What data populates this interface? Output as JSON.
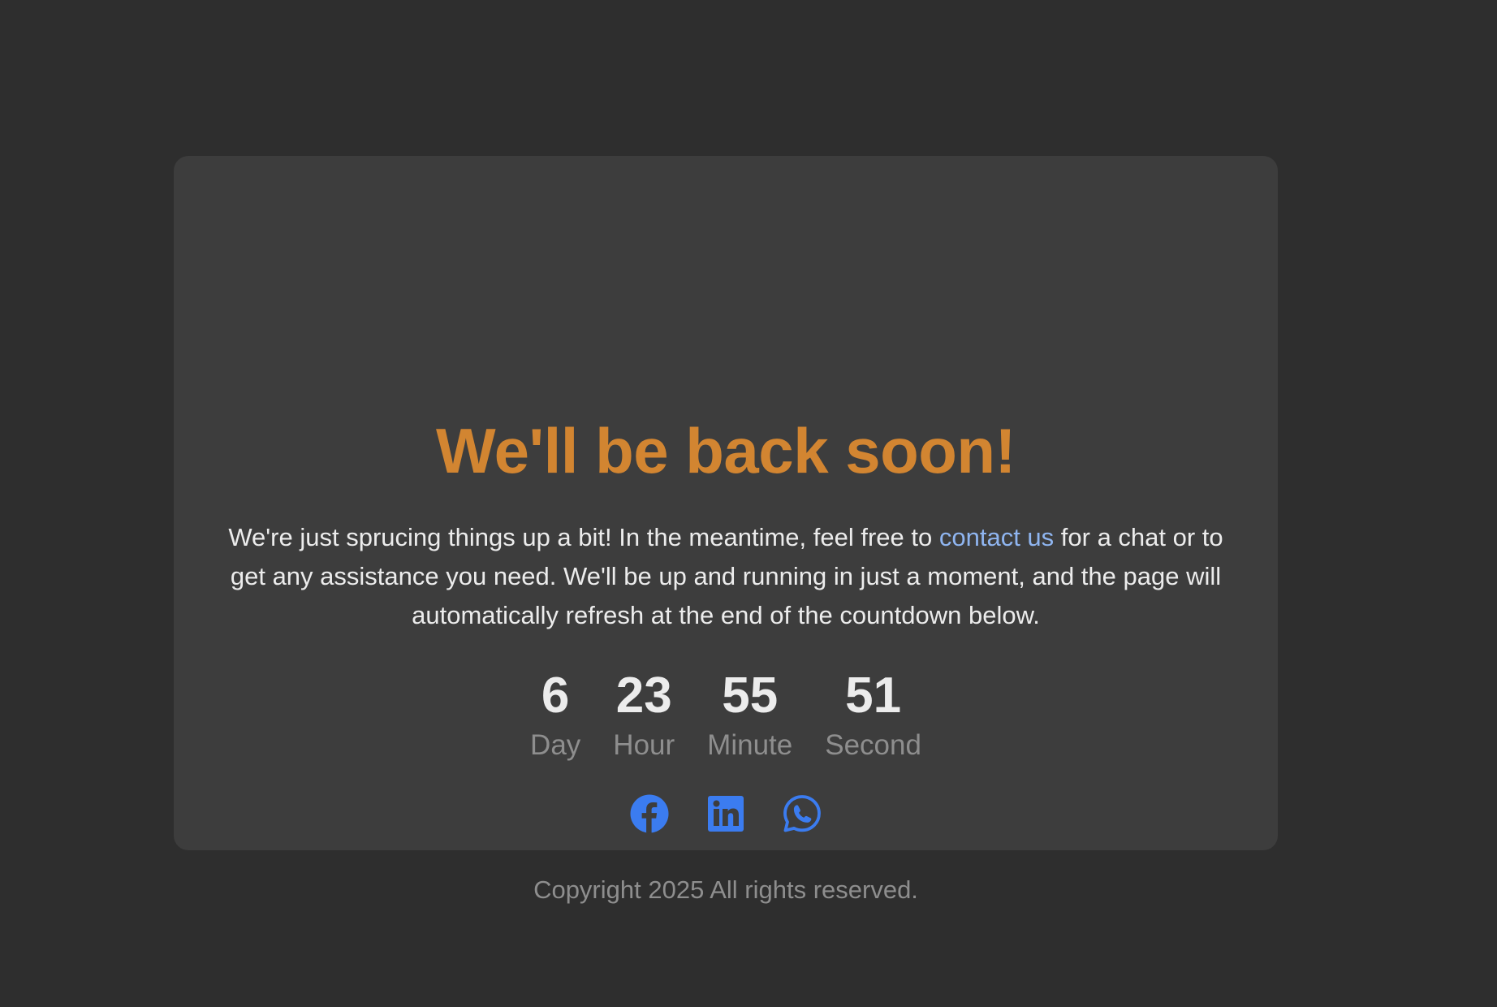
{
  "page": {
    "background_color": "#2e2e2e",
    "card_color": "#3d3d3d"
  },
  "heading": {
    "text": "We'll be back soon!",
    "color": "#d28531"
  },
  "message": {
    "before_link": "We're just sprucing things up a bit! In the meantime, feel free to ",
    "link_text": "contact us",
    "after_link": " for a chat or to get any assistance you need. We'll be up and running in just a moment, and the page will automatically refresh at the end of the countdown below.",
    "link_color": "#8fb5f0"
  },
  "countdown": {
    "units": [
      {
        "value": "6",
        "label": "Day"
      },
      {
        "value": "23",
        "label": "Hour"
      },
      {
        "value": "55",
        "label": "Minute"
      },
      {
        "value": "51",
        "label": "Second"
      }
    ]
  },
  "social": {
    "icon_color": "#3b7cf0",
    "links": [
      {
        "icon": "facebook-icon"
      },
      {
        "icon": "linkedin-icon"
      },
      {
        "icon": "whatsapp-icon"
      }
    ]
  },
  "footer": {
    "copyright": "Copyright 2025 All rights reserved."
  }
}
